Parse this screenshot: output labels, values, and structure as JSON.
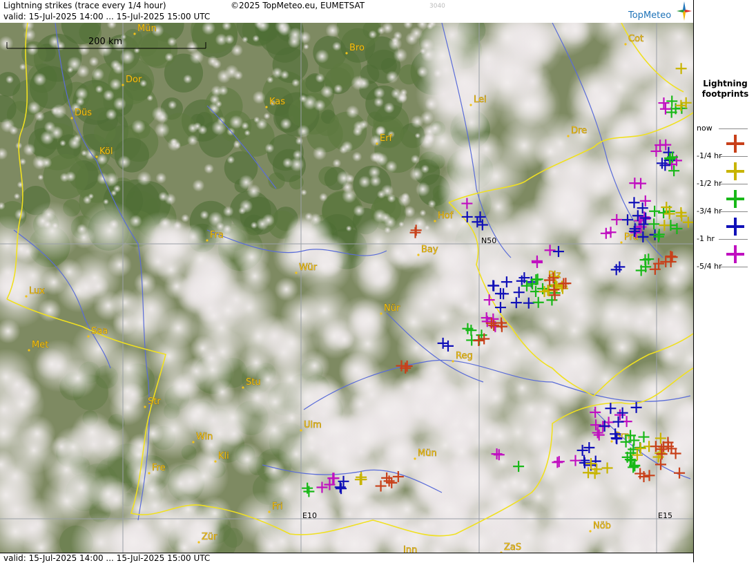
{
  "header": {
    "title": "Lightning strikes (trace every 1/4 hour)",
    "copyright": "©2025 TopMeteo.eu, EUMETSAT",
    "code": "3040",
    "valid": "valid:  15-Jul-2025 14:00 ... 15-Jul-2025 15:00 UTC",
    "logo": "TopMeteo"
  },
  "footer": {
    "valid": "valid:  15-Jul-2025 14:00 ... 15-Jul-2025 15:00 UTC"
  },
  "scale": {
    "label": "200 km"
  },
  "grid_labels": {
    "n50": "N50",
    "e10": "E10",
    "e15": "E15"
  },
  "cities": [
    "Mün",
    "Bro",
    "Cot",
    "Dor",
    "Kas",
    "Lei",
    "Düs",
    "Erf",
    "Dre",
    "Köl",
    "Hof",
    "Fra",
    "Bay",
    "Pra",
    "Wür",
    "Plz",
    "Lux",
    "Nür",
    "Saa",
    "Met",
    "Reg",
    "Stu",
    "Str",
    "Ulm",
    "Mün",
    "Win",
    "Kli",
    "Fre",
    "Brn",
    "Fri",
    "Nöb",
    "Zür",
    "Inn",
    "ZaS"
  ],
  "legend": {
    "title": "Lightning\nfootprints",
    "items": [
      {
        "label": "now",
        "color": "#c8401a"
      },
      {
        "label": "-1/4 hr",
        "color": "#c8b400"
      },
      {
        "label": "-1/2 hr",
        "color": "#18b818"
      },
      {
        "label": "-3/4 hr",
        "color": "#1010b8"
      },
      {
        "label": "-1 hr",
        "color": "#c010c0"
      },
      {
        "label": "-5/4 hr",
        "color": ""
      }
    ]
  },
  "colors": {
    "now": "#c8401a",
    "q1": "#c8b400",
    "q2": "#18b818",
    "q3": "#1010b8",
    "q4": "#c010c0",
    "border": "#f0e020",
    "river": "#5a6cd8",
    "city": "#f0c21b"
  }
}
